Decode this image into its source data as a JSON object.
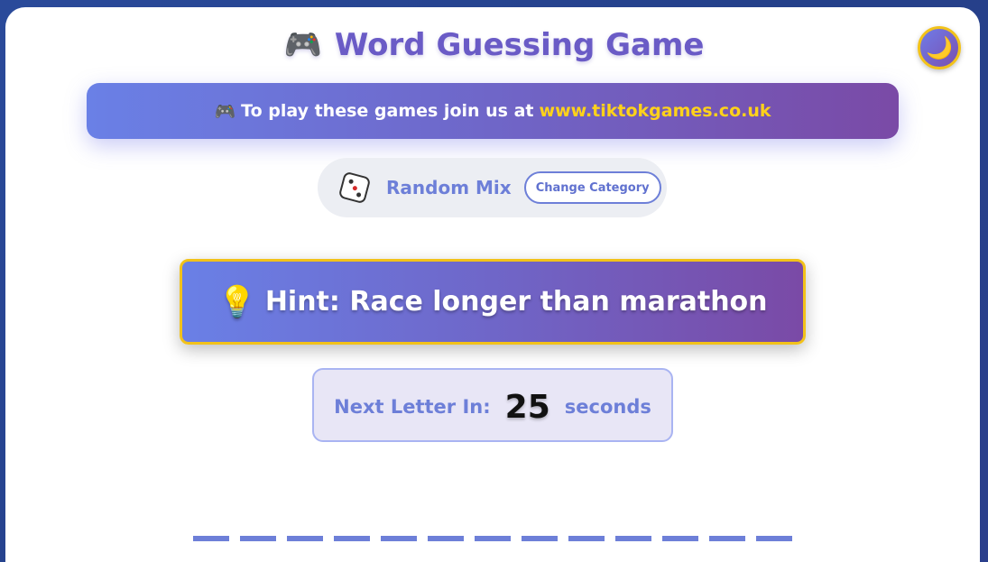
{
  "header": {
    "title": "Word Guessing Game",
    "title_icon": "gamepad-icon",
    "theme_toggle_icon": "moon-icon"
  },
  "banner": {
    "icon": "gamepad-icon",
    "text": "To play these games join us at",
    "link": "www.tiktokgames.co.uk"
  },
  "category": {
    "icon": "dice-icon",
    "name": "Random Mix",
    "change_label": "Change Category"
  },
  "hint": {
    "icon": "lightbulb-icon",
    "text": "Hint: Race longer than marathon"
  },
  "timer": {
    "label": "Next Letter In:",
    "value": "25",
    "unit": "seconds"
  },
  "word": {
    "letter_count": 13
  },
  "colors": {
    "accent": "#6d7fd8",
    "purple": "#7a4aa6",
    "gold": "#f2c21a",
    "link_yellow": "#ffd21a"
  }
}
